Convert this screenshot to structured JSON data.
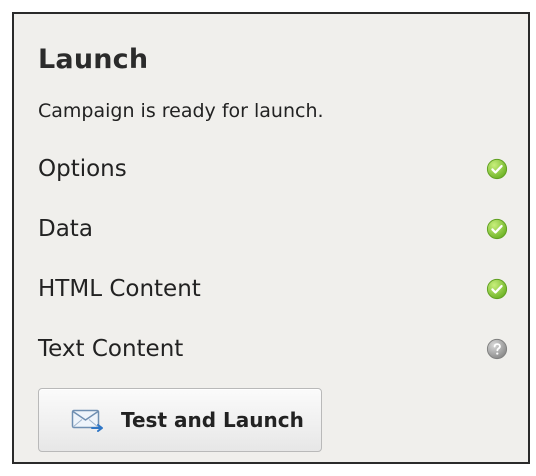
{
  "panel": {
    "title": "Launch",
    "subtitle": "Campaign is ready for launch."
  },
  "checks": [
    {
      "label": "Options",
      "status": "complete",
      "icon": "check-circle-icon",
      "color": "#8cc63f"
    },
    {
      "label": "Data",
      "status": "complete",
      "icon": "check-circle-icon",
      "color": "#8cc63f"
    },
    {
      "label": "HTML Content",
      "status": "complete",
      "icon": "check-circle-icon",
      "color": "#8cc63f"
    },
    {
      "label": "Text Content",
      "status": "unknown",
      "icon": "question-circle-icon",
      "color": "#8f8f8f"
    }
  ],
  "button": {
    "label": "Test and Launch",
    "icon": "mail-send-icon"
  }
}
